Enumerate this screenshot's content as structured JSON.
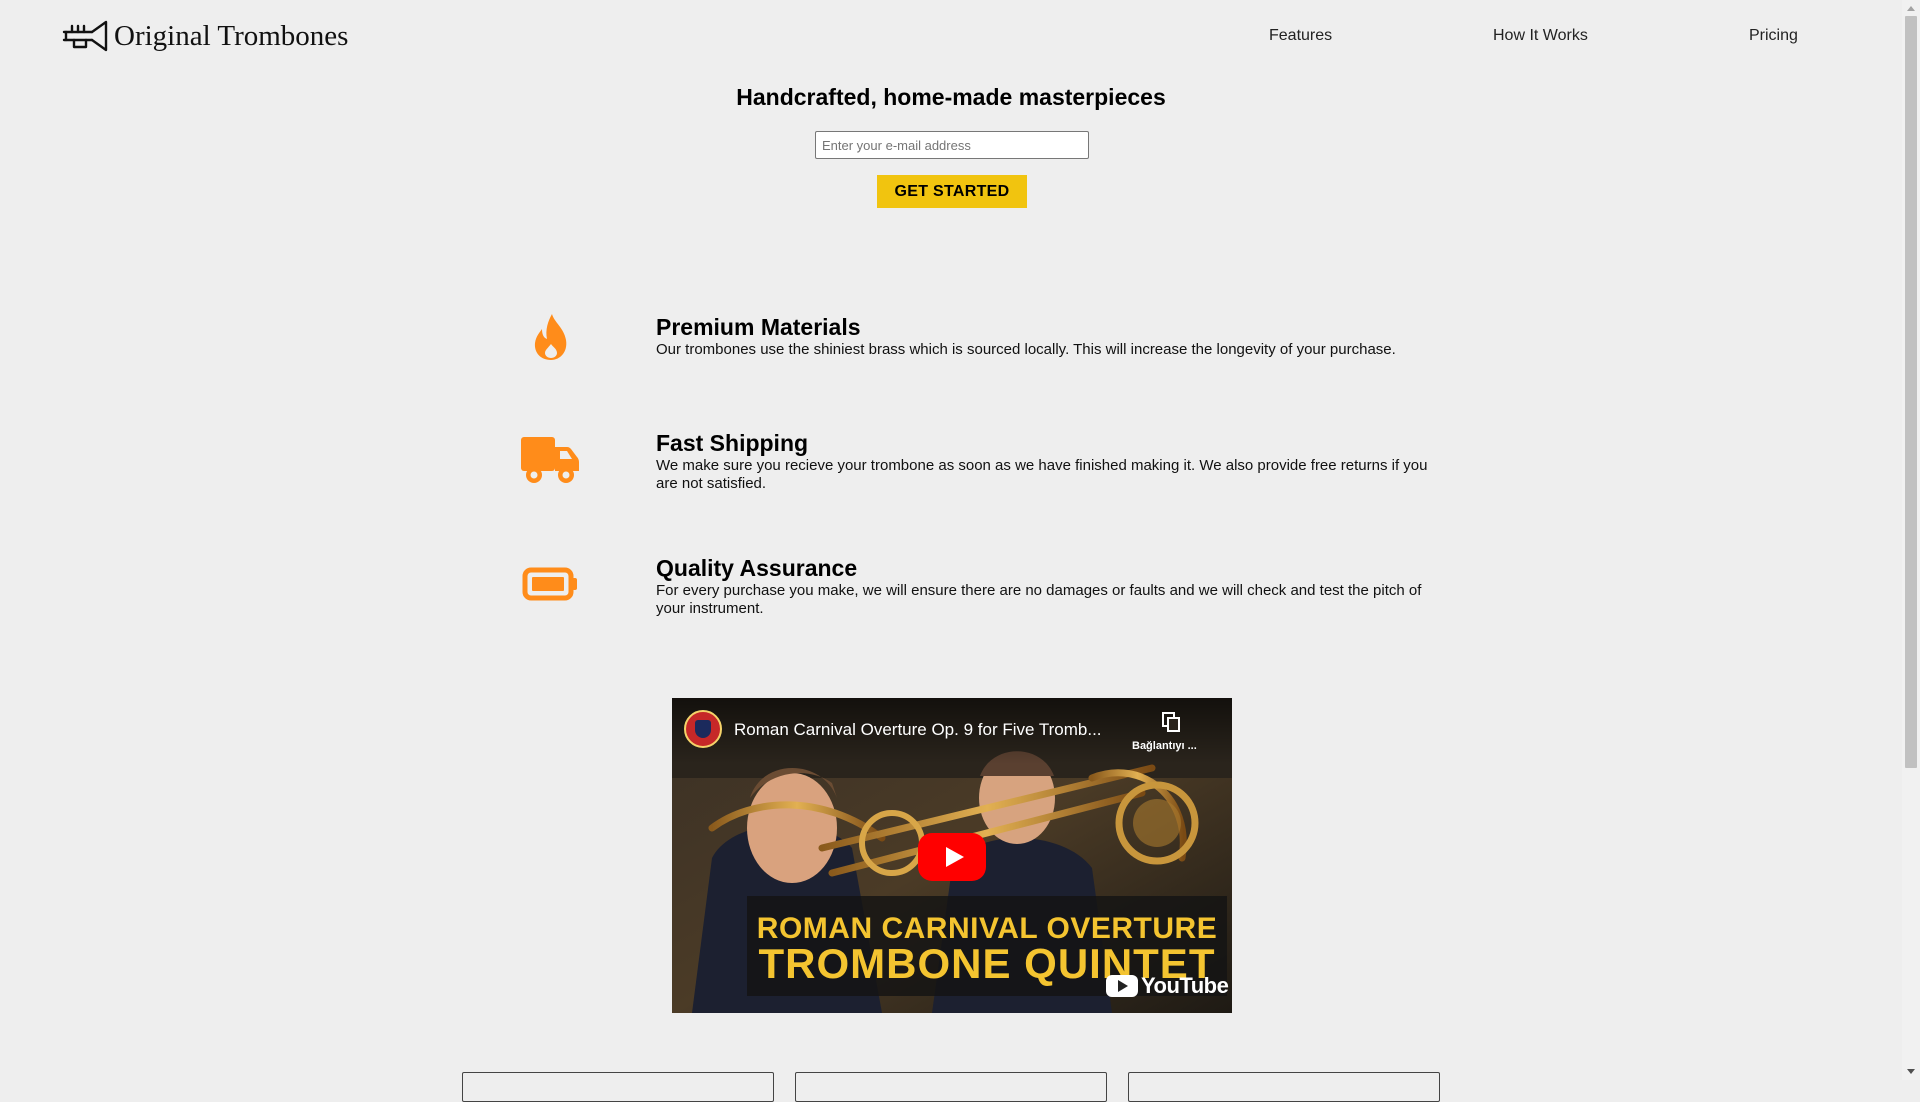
{
  "brand": {
    "name": "Original Trombones",
    "icon": "trombone-icon"
  },
  "nav": {
    "features": "Features",
    "how_it_works": "How It Works",
    "pricing": "Pricing"
  },
  "hero": {
    "title": "Handcrafted, home-made masterpieces",
    "email_placeholder": "Enter your e-mail address",
    "cta": "GET STARTED"
  },
  "features": [
    {
      "icon": "fire-icon",
      "title": "Premium Materials",
      "description": "Our trombones use the shiniest brass which is sourced locally. This will increase the longevity of your purchase."
    },
    {
      "icon": "truck-icon",
      "title": "Fast Shipping",
      "description": "We make sure you recieve your trombone as soon as we have finished making it. We also provide free returns if you are not satisfied."
    },
    {
      "icon": "battery-icon",
      "title": "Quality Assurance",
      "description": "For every purchase you make, we will ensure there are no damages or faults and we will check and test the pitch of your instrument."
    }
  ],
  "video": {
    "title": "Roman Carnival Overture Op. 9 for Five Tromb...",
    "share_label": "Bağlantıyı ...",
    "banner_line1": "ROMAN CARNIVAL OVERTURE",
    "banner_line2": "TROMBONE QUINTET",
    "platform": "YouTube"
  },
  "colors": {
    "accent": "#f1c40f",
    "icon_orange": "#ff8c1a",
    "background": "#eeeeee"
  }
}
